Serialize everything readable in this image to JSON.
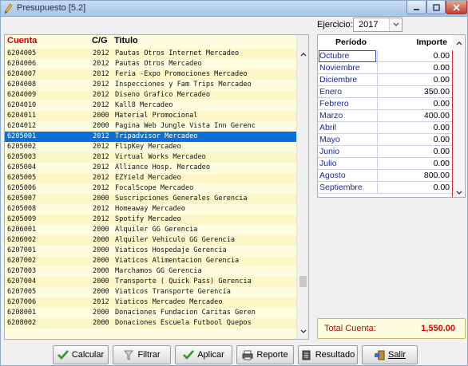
{
  "window": {
    "title": "Presupuesto [5.2]"
  },
  "list": {
    "headers": {
      "cuenta": "Cuenta",
      "cg": "C/G",
      "titulo": "Titulo"
    },
    "rows": [
      {
        "cuenta": "6204005",
        "cg": "2012",
        "titulo": "Pautas Otros Internet  Mercadeo"
      },
      {
        "cuenta": "6204006",
        "cg": "2012",
        "titulo": "Pautas Otros  Mercadeo"
      },
      {
        "cuenta": "6204007",
        "cg": "2012",
        "titulo": "Feria -Expo Promociones  Mercadeo"
      },
      {
        "cuenta": "6204008",
        "cg": "2012",
        "titulo": "Inspecciones y Fam Trips  Mercadeo"
      },
      {
        "cuenta": "6204009",
        "cg": "2012",
        "titulo": "Diseno Grafico  Mercadeo"
      },
      {
        "cuenta": "6204010",
        "cg": "2012",
        "titulo": "Kall8  Mercadeo"
      },
      {
        "cuenta": "6204011",
        "cg": "2000",
        "titulo": "Material Promocional"
      },
      {
        "cuenta": "6204012",
        "cg": "2000",
        "titulo": "Pagina Web Jungle Vista Inn  Gerenc"
      },
      {
        "cuenta": "6205001",
        "cg": "2012",
        "titulo": "Tripadvisor  Mercadeo"
      },
      {
        "cuenta": "6205002",
        "cg": "2012",
        "titulo": "FlipKey  Mercadeo"
      },
      {
        "cuenta": "6205003",
        "cg": "2012",
        "titulo": "Virtual Works  Mercadeo"
      },
      {
        "cuenta": "6205004",
        "cg": "2012",
        "titulo": "Alliance Hosp.  Mercadeo"
      },
      {
        "cuenta": "6205005",
        "cg": "2012",
        "titulo": "EZYield  Mercadeo"
      },
      {
        "cuenta": "6205006",
        "cg": "2012",
        "titulo": "FocalScope  Mercadeo"
      },
      {
        "cuenta": "6205007",
        "cg": "2000",
        "titulo": "Suscripciones Generales  Gerencia"
      },
      {
        "cuenta": "6205008",
        "cg": "2012",
        "titulo": "Homeaway  Mercadeo"
      },
      {
        "cuenta": "6205009",
        "cg": "2012",
        "titulo": "Spotify  Mercadeo"
      },
      {
        "cuenta": "6206001",
        "cg": "2000",
        "titulo": "Alquiler GG  Gerencia"
      },
      {
        "cuenta": "6206002",
        "cg": "2000",
        "titulo": "Alquiler Vehiculo GG  Gerencia"
      },
      {
        "cuenta": "6207001",
        "cg": "2000",
        "titulo": "Viaticos Hospedaje  Gerencia"
      },
      {
        "cuenta": "6207002",
        "cg": "2000",
        "titulo": "Viaticos Alimentacion  Gerencia"
      },
      {
        "cuenta": "6207003",
        "cg": "2000",
        "titulo": "Marchamos GG  Gerencia"
      },
      {
        "cuenta": "6207004",
        "cg": "2000",
        "titulo": "Transporte ( Quick Pass)  Gerencia"
      },
      {
        "cuenta": "6207005",
        "cg": "2000",
        "titulo": "Viaticos Transporte  Gerencia"
      },
      {
        "cuenta": "6207006",
        "cg": "2012",
        "titulo": "Viaticos Mercadeo  Mercadeo"
      },
      {
        "cuenta": "6208001",
        "cg": "2000",
        "titulo": "Donaciones Fundacion Caritas  Geren"
      },
      {
        "cuenta": "6208002",
        "cg": "2000",
        "titulo": "Donaciones Escuela Futbool Quepos"
      }
    ],
    "selected_cuenta": "6205001"
  },
  "ejercicio": {
    "label": "Ejercicio:",
    "value": "2017"
  },
  "periods": {
    "headers": {
      "periodo": "Período",
      "importe": "Importe"
    },
    "rows": [
      {
        "periodo": "Octubre",
        "importe": "0.00"
      },
      {
        "periodo": "Noviembre",
        "importe": "0.00"
      },
      {
        "periodo": "Diciembre",
        "importe": "0.00"
      },
      {
        "periodo": "Enero",
        "importe": "350.00"
      },
      {
        "periodo": "Febrero",
        "importe": "0.00"
      },
      {
        "periodo": "Marzo",
        "importe": "400.00"
      },
      {
        "periodo": "Abril",
        "importe": "0.00"
      },
      {
        "periodo": "Mayo",
        "importe": "0.00"
      },
      {
        "periodo": "Junio",
        "importe": "0.00"
      },
      {
        "periodo": "Julio",
        "importe": "0.00"
      },
      {
        "periodo": "Agosto",
        "importe": "800.00"
      },
      {
        "periodo": "Septiembre",
        "importe": "0.00"
      }
    ]
  },
  "total": {
    "label": "Total Cuenta:",
    "value": "1,550.00"
  },
  "buttons": {
    "calcular": "Calcular",
    "filtrar": "Filtrar",
    "aplicar": "Aplicar",
    "reporte": "Reporte",
    "resultado": "Resultado",
    "salir": "Salir"
  },
  "colors": {
    "selection": "#0a6fd6",
    "header_red": "#d20000",
    "list_bg": "#fffde0",
    "period_name": "#1a2a9a"
  },
  "icons": [
    "pencil-icon",
    "minimize-icon",
    "maximize-icon",
    "close-icon",
    "check-icon",
    "funnel-icon",
    "printer-icon",
    "document-icon",
    "exit-icon",
    "chevron-up-icon",
    "chevron-down-icon"
  ]
}
